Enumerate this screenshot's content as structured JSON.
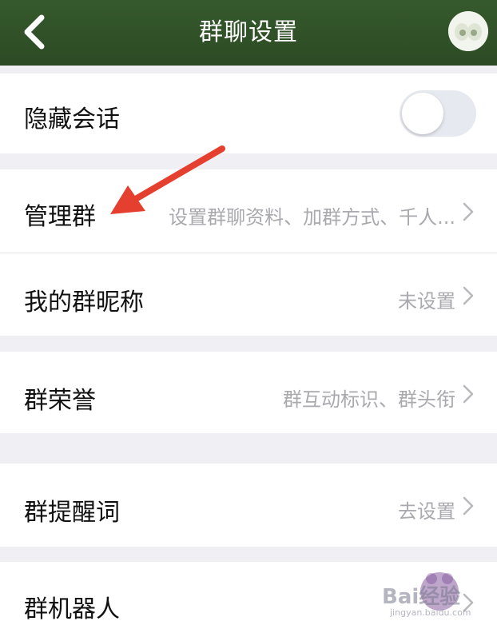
{
  "header": {
    "title": "群聊设置",
    "back_icon": "chevron-left-icon",
    "avatar_icon": "group-avatar-icon"
  },
  "settings": {
    "hide_chat": {
      "label": "隐藏会话",
      "toggle_on": false
    },
    "manage_group": {
      "label": "管理群",
      "value": "设置群聊资料、加群方式、千人..."
    },
    "my_nickname": {
      "label": "我的群昵称",
      "value": "未设置"
    },
    "group_honor": {
      "label": "群荣誉",
      "value": "群互动标识、群头衔"
    },
    "group_reminder": {
      "label": "群提醒词",
      "value": "去设置"
    },
    "group_robot": {
      "label": "群机器人"
    }
  },
  "annotation": {
    "arrow_color": "#e5402f"
  },
  "watermark": {
    "text": "Bai经验",
    "url": "jingyan.baidu.com"
  },
  "colors": {
    "header_bg": "#2e4f27",
    "page_bg": "#efeff4",
    "secondary_text": "#a9a9ae"
  }
}
